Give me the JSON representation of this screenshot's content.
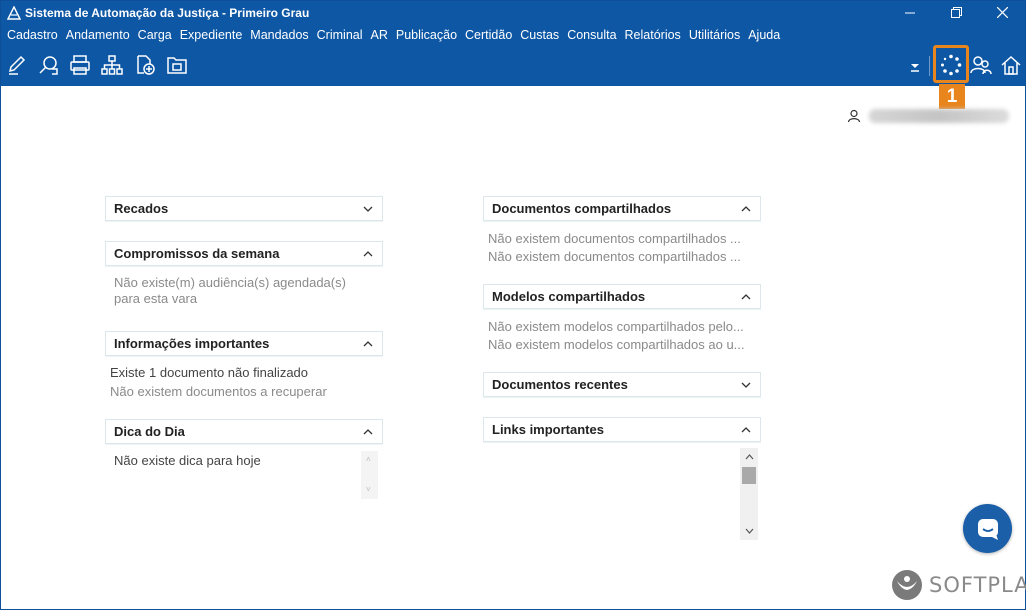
{
  "window": {
    "title": "Sistema de Automação da Justiça - Primeiro Grau"
  },
  "menu": [
    "Cadastro",
    "Andamento",
    "Carga",
    "Expediente",
    "Mandados",
    "Criminal",
    "AR",
    "Publicação",
    "Certidão",
    "Custas",
    "Consulta",
    "Relatórios",
    "Utilitários",
    "Ajuda"
  ],
  "toolbar": {
    "left_icons": [
      "edit-icon",
      "search-document-icon",
      "printer-icon",
      "org-chart-icon",
      "add-document-icon",
      "folder-transfer-icon"
    ],
    "right_icons": [
      "dropdown-icon",
      "loading-spinner-icon",
      "users-icon",
      "home-icon"
    ]
  },
  "callout": {
    "number": "1",
    "color": "#e8851d"
  },
  "panels_left": {
    "recados": {
      "title": "Recados"
    },
    "compromissos": {
      "title": "Compromissos da semana",
      "line1": "Não existe(m) audiência(s) agendada(s)",
      "line2": "para esta vara"
    },
    "informacoes": {
      "title": "Informações importantes",
      "line1": "Existe 1 documento não finalizado",
      "line2": "Não existem documentos a recuperar"
    },
    "dica": {
      "title": "Dica do Dia",
      "line1": "Não existe dica para hoje"
    }
  },
  "panels_right": {
    "docs_compartilhados": {
      "title": "Documentos compartilhados",
      "line1": "Não existem documentos compartilhados ...",
      "line2": "Não existem documentos compartilhados ..."
    },
    "modelos": {
      "title": "Modelos compartilhados",
      "line1": "Não existem modelos compartilhados pelo...",
      "line2": "Não existem modelos compartilhados ao u..."
    },
    "recentes": {
      "title": "Documentos recentes"
    },
    "links": {
      "title": "Links importantes"
    }
  },
  "brand": {
    "name": "SOFTPLAN"
  },
  "colors": {
    "header_blue": "#0d57a5",
    "accent_orange": "#e8851d",
    "chat_blue": "#1a5fa8"
  }
}
